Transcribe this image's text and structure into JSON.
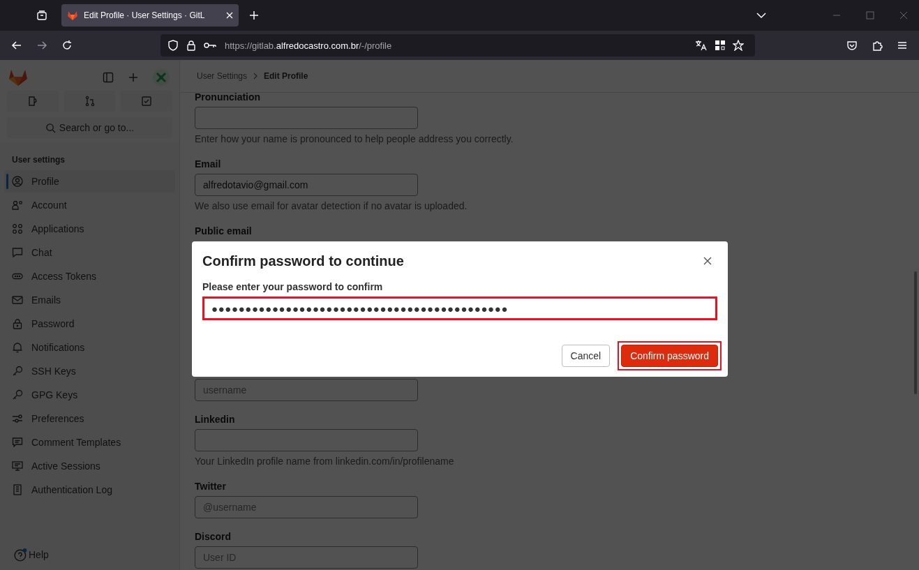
{
  "browser": {
    "tabs": [
      {
        "title": "Edit Profile · User Settings · GitL",
        "selected": true
      }
    ],
    "url": {
      "scheme_host": "https://gitlab.",
      "domain": "alfredocastro.com.br",
      "path": "/-/profile"
    }
  },
  "sidebar": {
    "search_placeholder": "Search or go to...",
    "section_title": "User settings",
    "items": [
      {
        "label": "Profile",
        "selected": true
      },
      {
        "label": "Account",
        "selected": false
      },
      {
        "label": "Applications",
        "selected": false
      },
      {
        "label": "Chat",
        "selected": false
      },
      {
        "label": "Access Tokens",
        "selected": false
      },
      {
        "label": "Emails",
        "selected": false
      },
      {
        "label": "Password",
        "selected": false
      },
      {
        "label": "Notifications",
        "selected": false
      },
      {
        "label": "SSH Keys",
        "selected": false
      },
      {
        "label": "GPG Keys",
        "selected": false
      },
      {
        "label": "Preferences",
        "selected": false
      },
      {
        "label": "Comment Templates",
        "selected": false
      },
      {
        "label": "Active Sessions",
        "selected": false
      },
      {
        "label": "Authentication Log",
        "selected": false
      }
    ],
    "help": "Help"
  },
  "breadcrumb": [
    "User Settings",
    "Edit Profile"
  ],
  "form": {
    "upper": [
      {
        "label": "Pronunciation",
        "help": "Enter how your name is pronounced to help people address you correctly."
      },
      {
        "label": "Email",
        "value": "alfredotavio@gmail.com",
        "help": "We also use email for avatar detection if no avatar is uploaded."
      },
      {
        "label": "Public email"
      }
    ],
    "lower": [
      {
        "placeholder": "username"
      },
      {
        "label": "Linkedin",
        "help": "Your LinkedIn profile name from linkedin.com/in/profilename"
      },
      {
        "label": "Twitter",
        "placeholder": "@username"
      },
      {
        "label": "Discord",
        "placeholder": "User ID"
      }
    ]
  },
  "modal": {
    "title": "Confirm password to continue",
    "label": "Please enter your password to confirm",
    "password": "●●●●●●●●●●●●●●●●●●●●●●●●●●●●●●●●●●●●●●●●●●●●",
    "password_highlighted": true,
    "buttons": [
      {
        "label": "Cancel",
        "kind": "secondary",
        "highlighted": false
      },
      {
        "label": "Confirm password",
        "kind": "primary",
        "highlighted": true
      }
    ]
  }
}
